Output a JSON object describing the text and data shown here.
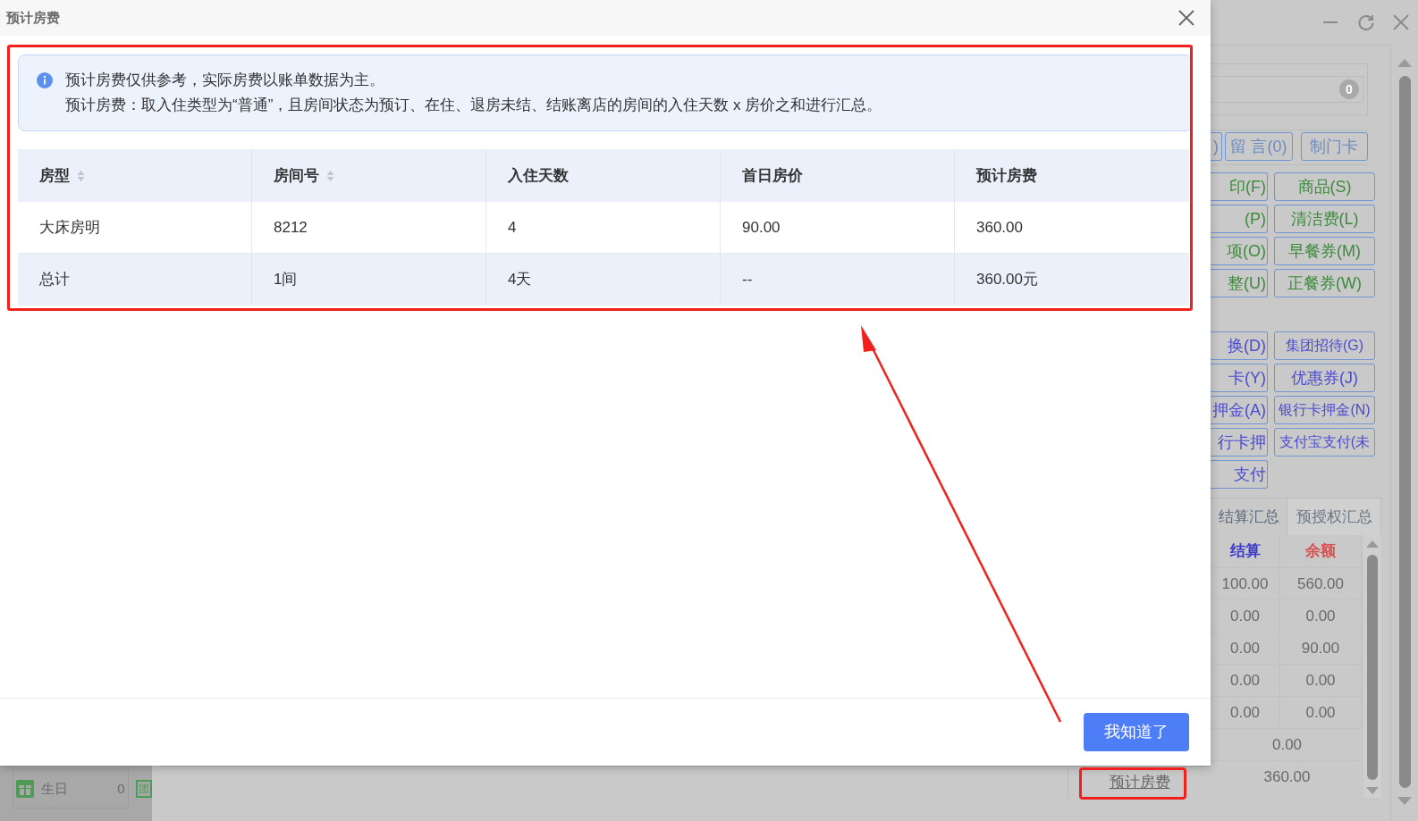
{
  "dialog": {
    "title": "预计房费",
    "notice": [
      "预计房费仅供参考，实际房费以账单数据为主。",
      "预计房费：取入住类型为“普通”，且房间状态为预订、在住、退房未结、结账离店的房间的入住天数 x 房价之和进行汇总。"
    ],
    "table": {
      "columns": [
        {
          "label": "房型",
          "sortable": true
        },
        {
          "label": "房间号",
          "sortable": true
        },
        {
          "label": "入住天数",
          "sortable": false
        },
        {
          "label": "首日房价",
          "sortable": false
        },
        {
          "label": "预计房费",
          "sortable": false
        }
      ],
      "rows": [
        [
          "大床房明",
          "8212",
          "4",
          "90.00",
          "360.00"
        ]
      ],
      "total": [
        "总计",
        "1间",
        "4天",
        "--",
        "360.00元"
      ]
    },
    "confirm_button": "我知道了"
  },
  "background": {
    "message_badge": "0",
    "top_buttons": [
      ")",
      "留 言(0)",
      "制门卡"
    ],
    "charge_buttons": [
      [
        "印(F)",
        "商品(S)"
      ],
      [
        "(P)",
        "清洁费(L)"
      ],
      [
        "项(O)",
        "早餐券(M)"
      ],
      [
        "整(U)",
        "正餐券(W)"
      ]
    ],
    "payment_buttons": [
      [
        "换(D)",
        "集团招待(G)"
      ],
      [
        "卡(Y)",
        "优惠券(J)"
      ],
      [
        "押金(A)",
        "银行卡押金(N)"
      ],
      [
        "行卡押",
        "支付宝支付(未"
      ],
      [
        "支付"
      ]
    ],
    "summary_tabs": [
      {
        "label": "结算汇总",
        "selected": true
      },
      {
        "label": "预授权汇总",
        "selected": false
      }
    ],
    "summary_columns": [
      "结算",
      "余额"
    ],
    "summary_rows": [
      [
        "100.00",
        "560.00"
      ],
      [
        "0.00",
        "0.00"
      ],
      [
        "0.00",
        "90.00"
      ],
      [
        "0.00",
        "0.00"
      ],
      [
        "0.00",
        "0.00"
      ]
    ],
    "summary_merged": [
      "0.00",
      "360.00"
    ],
    "estimate_link": "预计房费",
    "sidebar_item": {
      "label": "生日",
      "count": "0",
      "next_icon_char": "团"
    }
  }
}
